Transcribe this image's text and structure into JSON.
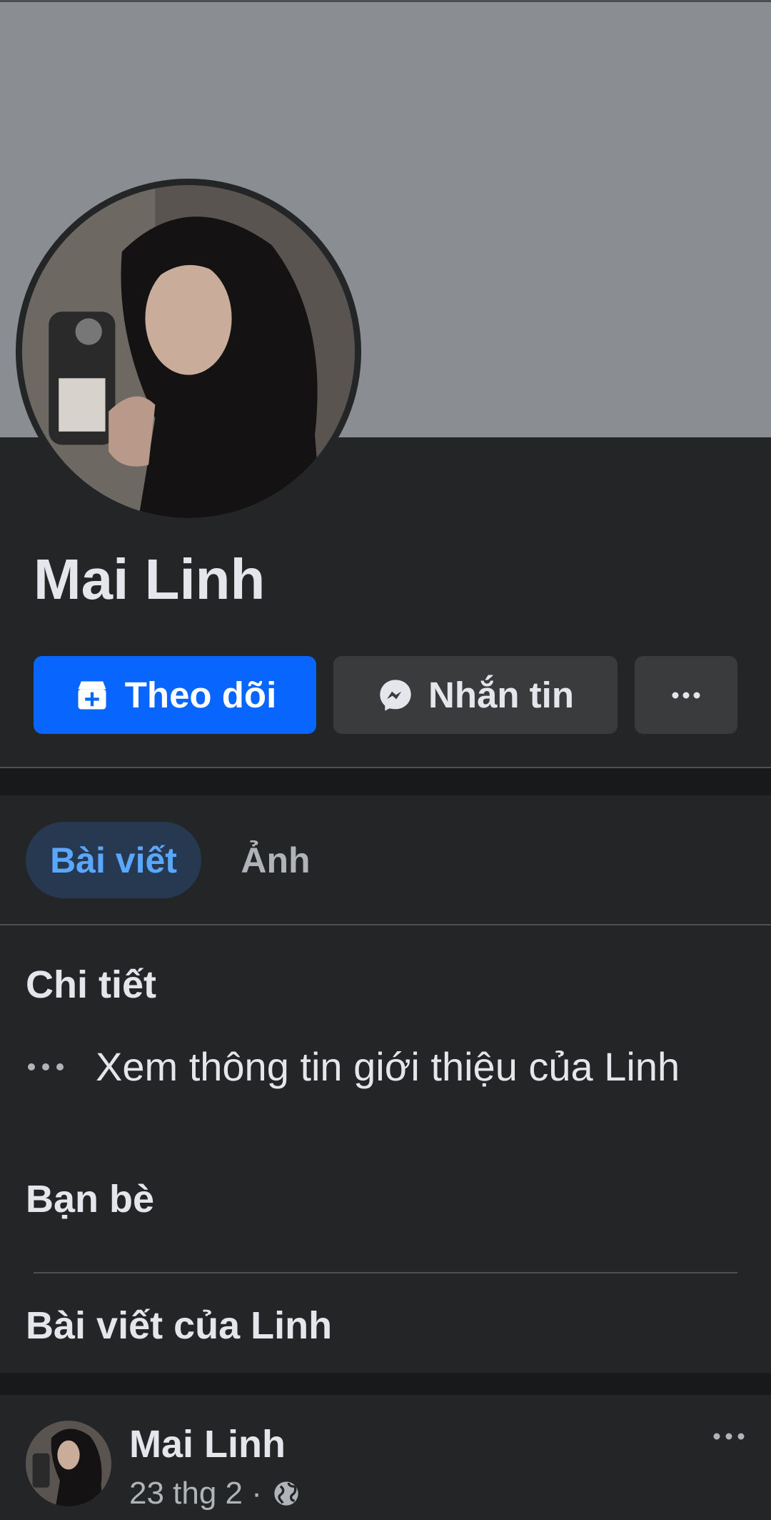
{
  "profile": {
    "name": "Mai Linh"
  },
  "actions": {
    "follow_label": "Theo dõi",
    "message_label": "Nhắn tin"
  },
  "tabs": [
    {
      "label": "Bài viết",
      "active": true
    },
    {
      "label": "Ảnh",
      "active": false
    }
  ],
  "details": {
    "title": "Chi tiết",
    "about_text": "Xem thông tin giới thiệu của Linh"
  },
  "friends": {
    "title": "Bạn bè"
  },
  "posts_section": {
    "title": "Bài viết của Linh"
  },
  "post": {
    "author": "Mai Linh",
    "meta": "23 thg 2 ·",
    "privacy_icon": "globe-icon"
  },
  "colors": {
    "background": "#242526",
    "cover": "#8a8d91",
    "primary": "#0866ff",
    "secondary_button": "#3a3b3c",
    "active_tab_bg": "#263951",
    "active_tab_text": "#5aa7ff"
  }
}
